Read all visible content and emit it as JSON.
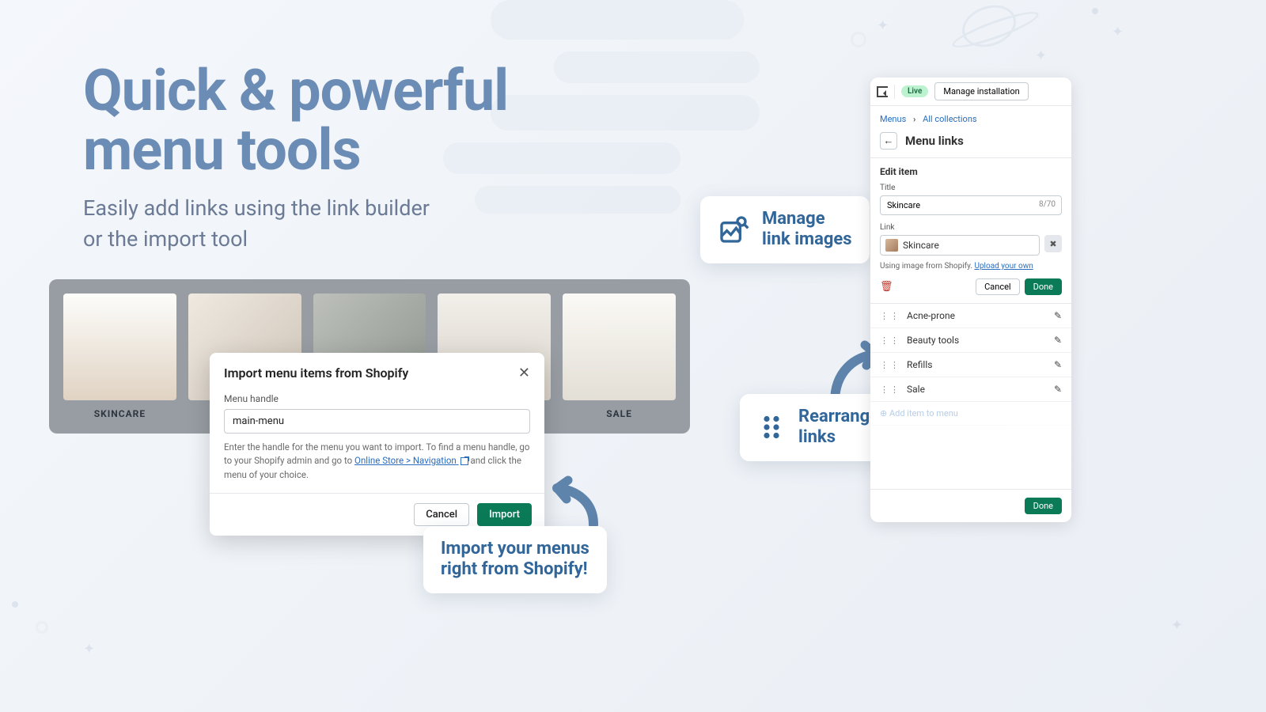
{
  "hero": {
    "title_l1": "Quick & powerful",
    "title_l2": "menu tools",
    "sub_l1": "Easily add links using the link builder",
    "sub_l2": "or the import tool"
  },
  "gallery": {
    "tiles": [
      {
        "caption": "SKINCARE"
      },
      {
        "caption": ""
      },
      {
        "caption": ""
      },
      {
        "caption": ""
      },
      {
        "caption": "SALE"
      }
    ]
  },
  "import_modal": {
    "title": "Import menu items from Shopify",
    "field_label": "Menu handle",
    "value": "main-menu",
    "help_pre": "Enter the handle for the menu you want to import. To find a menu handle, go to your Shopify admin and go to ",
    "help_link": "Online Store > Navigation",
    "help_post": " and click the menu of your choice.",
    "cancel": "Cancel",
    "import": "Import"
  },
  "callouts": {
    "import_l1": "Import your menus",
    "import_l2": "right from Shopify!",
    "manage_l1": "Manage",
    "manage_l2": "link images",
    "rearrange_l1": "Rearrange",
    "rearrange_l2": "links"
  },
  "panel": {
    "badge": "Live",
    "manage_btn": "Manage installation",
    "crumb1": "Menus",
    "crumb2": "All collections",
    "title": "Menu links",
    "section_head": "Edit item",
    "title_label": "Title",
    "title_value": "Skincare",
    "title_counter": "8/70",
    "link_label": "Link",
    "link_value": "Skincare",
    "hint_pre": "Using image from Shopify. ",
    "hint_link": "Upload your own",
    "cancel": "Cancel",
    "done": "Done",
    "items": [
      {
        "label": "Acne-prone"
      },
      {
        "label": "Beauty tools"
      },
      {
        "label": "Refills"
      },
      {
        "label": "Sale"
      }
    ],
    "add_item": "Add item to menu",
    "footer_done": "Done"
  }
}
